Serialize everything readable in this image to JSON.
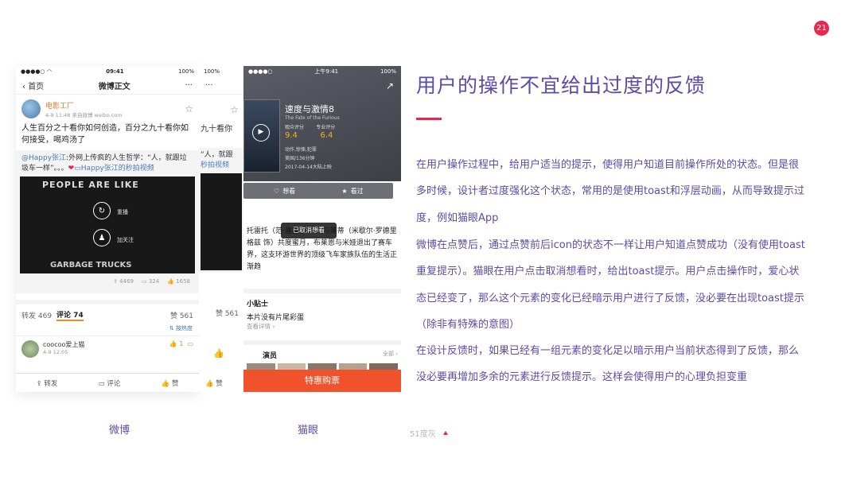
{
  "page_number": "21",
  "heading": "用户的操作不宜给出过度的反馈",
  "paragraphs": [
    "在用户操作过程中，给用户适当的提示，使得用户知道目前操作所处的状态。但是很多时候，设计者过度强化这个状态，常用的是使用toast和浮层动画，从而导致提示过度，例如猫眼App",
    "微博在点赞后，通过点赞前后icon的状态不一样让用户知道点赞成功（没有使用toast重复提示）。猫眼在用户点击取消想看时，给出toast提示。用户点击操作时，爱心状态已经变了，那么这个元素的变化已经暗示用户进行了反馈，没必要在出现toast提示（除非有特殊的意图）",
    "在设计反馈时，如果已经有一组元素的变化足以暗示用户当前状态得到了反馈，那么没必要再增加多余的元素进行反馈提示。这样会使得用户的心理负担变重"
  ],
  "captions": {
    "weibo": "微博",
    "maoyan": "猫眼"
  },
  "footer": "51度灰",
  "weibo": {
    "status_time": "09:41",
    "status_battery": "100%",
    "back": "首页",
    "title": "微博正文",
    "more": "···",
    "user": "电影工厂",
    "meta": "4-9 11:48  来自微博 weibo.com",
    "post": "人生百分之十看你如何创造，百分之九十看你如何接受，喝鸡汤了",
    "repost_user": "@Happy张江",
    "repost_text": ":外网上传疯的人生哲学：“人，就跟垃圾车一样”。。。",
    "repost_link": "Happy张江的秒拍视频",
    "video_top": "PEOPLE ARE LIKE",
    "video_bottom": "GARBAGE TRUCKS",
    "replay": "重播",
    "follow": "加关注",
    "stats": [
      "4469",
      "324",
      "1658"
    ],
    "tab_repost": "转发 469",
    "tab_comment": "评论 74",
    "tab_like": "赞 561",
    "sort": "按热度",
    "commenter": "coocoo爱上猫",
    "comment_time": "4-9 12:05",
    "comment_likes": "1",
    "bottom": [
      "转发",
      "评论",
      "赞"
    ],
    "ghost_text": [
      "九十看你",
      "秒拍视频",
      "“人，就跟"
    ]
  },
  "maoyan": {
    "status_time": "上午9:41",
    "status_battery": "100%",
    "title": "速度与激情8",
    "subtitle": "The Fate of the Furious",
    "audience": "观众评分",
    "pro": "专业评分",
    "score1": "9.4",
    "score2": "6.4",
    "genre": "动作,惊悚,犯罪",
    "region": "美国/136分钟",
    "release": "2017-04-14大陆上映",
    "want": "想看",
    "seen": "看过",
    "toast": "已取消想看",
    "desc": "托雷托（范·迪塞尔 饰）与莱蒂（米歇尔·罗德里格兹 饰）共度蜜月，布莱恩与米娅退出了赛车界，这支环游世界的顶级飞车家族队伍的生活正渐趋",
    "tips": "小贴士",
    "tip1": "本片没有片尾彩蛋",
    "tip_more": "查看详情",
    "cast": "演员",
    "cast_all": "全部",
    "buy": "特惠购票"
  }
}
